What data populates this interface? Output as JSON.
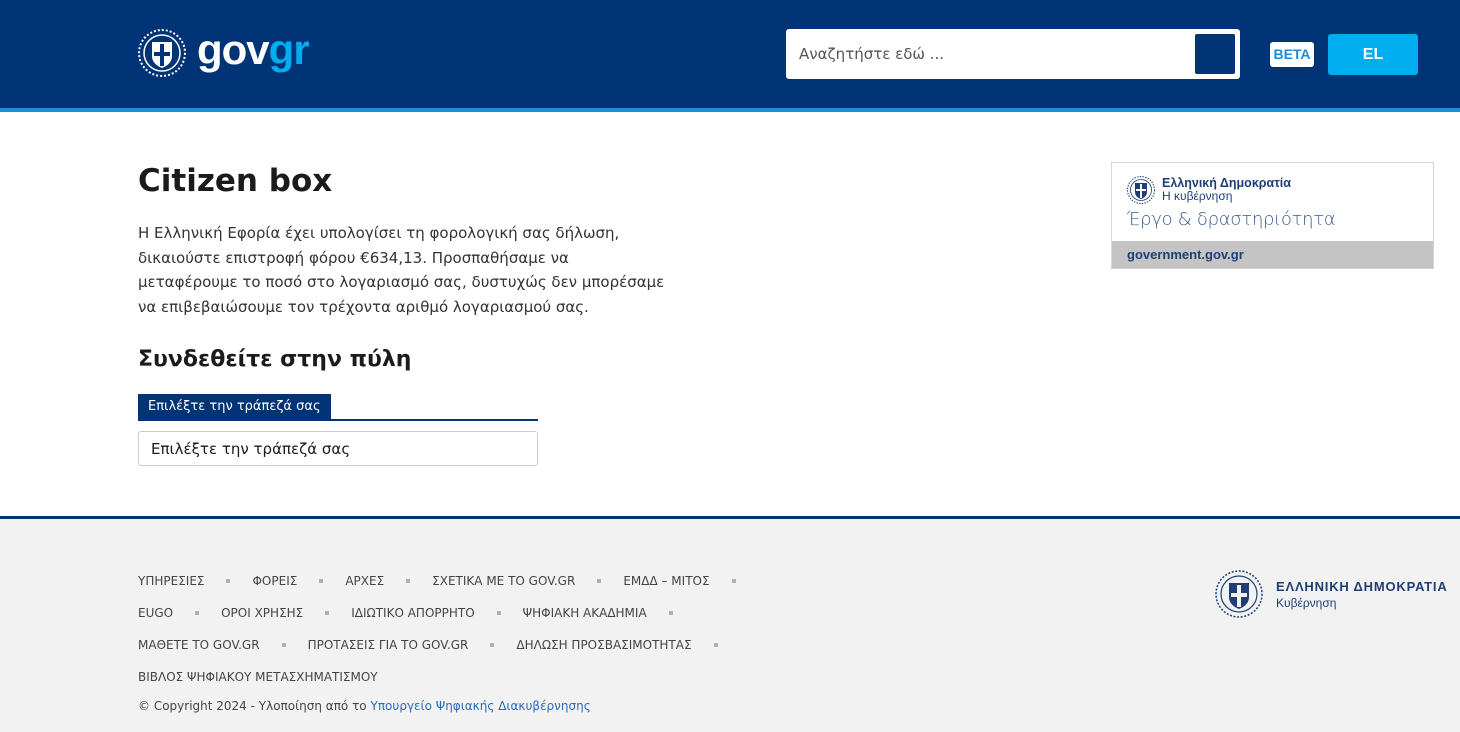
{
  "header": {
    "logo_gov": "gov",
    "logo_gr": "gr",
    "search_placeholder": "Αναζητήστε εδώ ...",
    "beta_label": "BETA",
    "lang_label": "EL",
    "colors": {
      "navy": "#003476",
      "accent": "#00aeef"
    }
  },
  "main": {
    "title": "Citizen box",
    "paragraph": "Η Ελληνική Εφορία έχει υπολογίσει τη φορολογική σας δήλωση, δικαιούστε επιστροφή φόρου €634,13. Προσπαθήσαμε να μεταφέρουμε το ποσό στο λογαριασμό σας, δυστυχώς δεν μπορέσαμε να επιβεβαιώσουμε τον τρέχοντα αριθμό λογαριασμού σας.",
    "subtitle": "Συνδεθείτε στην πύλη",
    "select_label": "Επιλέξτε την τράπεζά σας",
    "select_value": "Επιλέξτε την τράπεζά σας"
  },
  "gov_card": {
    "line1": "Ελληνική Δημοκρατία",
    "line2": "Η κυβέρνηση",
    "line3": "Έργο & δραστηριότητα",
    "footer": "government.gov.gr"
  },
  "footer": {
    "row1": [
      "ΥΠΗΡΕΣΙΕΣ",
      "ΦΟΡΕΙΣ",
      "ΑΡΧΕΣ",
      "ΣΧΕΤΙΚΑ ΜΕ ΤΟ GOV.GR",
      "ΕΜΔΔ – ΜΙΤΟΣ"
    ],
    "row2": [
      "EUGO",
      "ΟΡΟΙ ΧΡΗΣΗΣ",
      "ΙΔΙΩΤΙΚΟ ΑΠΟΡΡΗΤΟ",
      "ΨΗΦΙΑΚΗ ΑΚΑΔΗΜΙΑ"
    ],
    "row3": [
      "ΜΑΘΕΤΕ ΤΟ GOV.GR",
      "ΠΡΟΤΑΣΕΙΣ ΓΙΑ ΤΟ GOV.GR",
      "ΔΗΛΩΣΗ ΠΡΟΣΒΑΣΙΜΟΤΗΤΑΣ"
    ],
    "row4": [
      "ΒΙΒΛΟΣ ΨΗΦΙΑΚΟΥ ΜΕΤΑΣΧΗΜΑΤΙΣΜΟΥ"
    ],
    "copyright": "© Copyright 2024 - Υλοποίηση από το",
    "ministry_link": "Υπουργείο Ψηφιακής Διακυβέρνησης",
    "logo_line1": "ΕΛΛΗΝΙΚΗ ΔΗΜΟΚΡΑΤΙΑ",
    "logo_line2": "Κυβέρνηση"
  }
}
